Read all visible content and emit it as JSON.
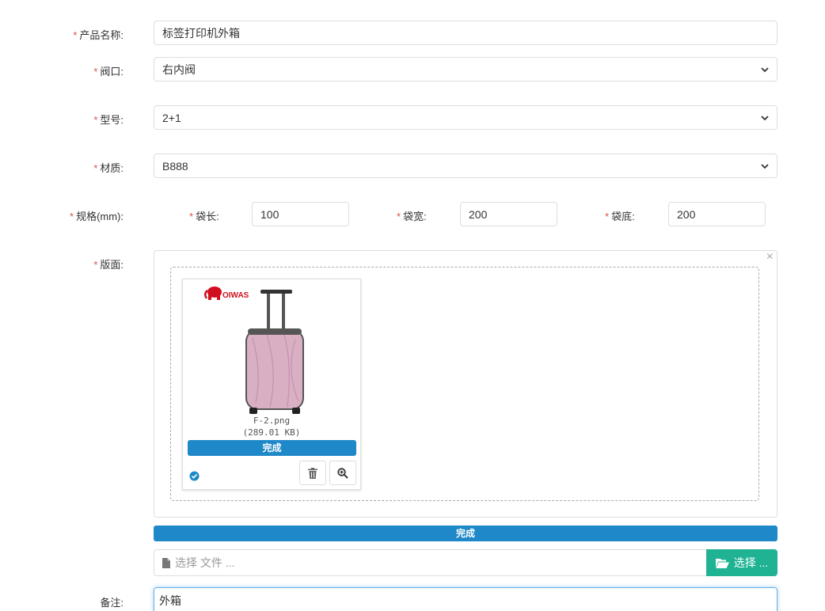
{
  "form": {
    "product_name": {
      "label": "产品名称:",
      "value": "标签打印机外箱"
    },
    "valve": {
      "label": "阀口:",
      "value": "右内阀"
    },
    "model": {
      "label": "型号:",
      "value": "2+1"
    },
    "material": {
      "label": "材质:",
      "value": "B888"
    },
    "spec": {
      "label": "规格(mm):",
      "length": {
        "label": "袋长:",
        "value": "100"
      },
      "width": {
        "label": "袋宽:",
        "value": "200"
      },
      "bottom": {
        "label": "袋底:",
        "value": "200"
      }
    },
    "layout": {
      "label": "版面:",
      "file": {
        "name": "F-2.png",
        "size": "(289.01 KB)",
        "status": "完成",
        "brand_text": "OIWAS"
      },
      "overall_status": "完成",
      "file_picker": {
        "placeholder": "选择 文件 ...",
        "button_label": "选择 ..."
      }
    },
    "remark": {
      "label": "备注:",
      "value": "外箱"
    },
    "required_mark": "*"
  },
  "colors": {
    "primary": "#1e88c9",
    "success": "#1fb393",
    "required": "#d9534f"
  }
}
